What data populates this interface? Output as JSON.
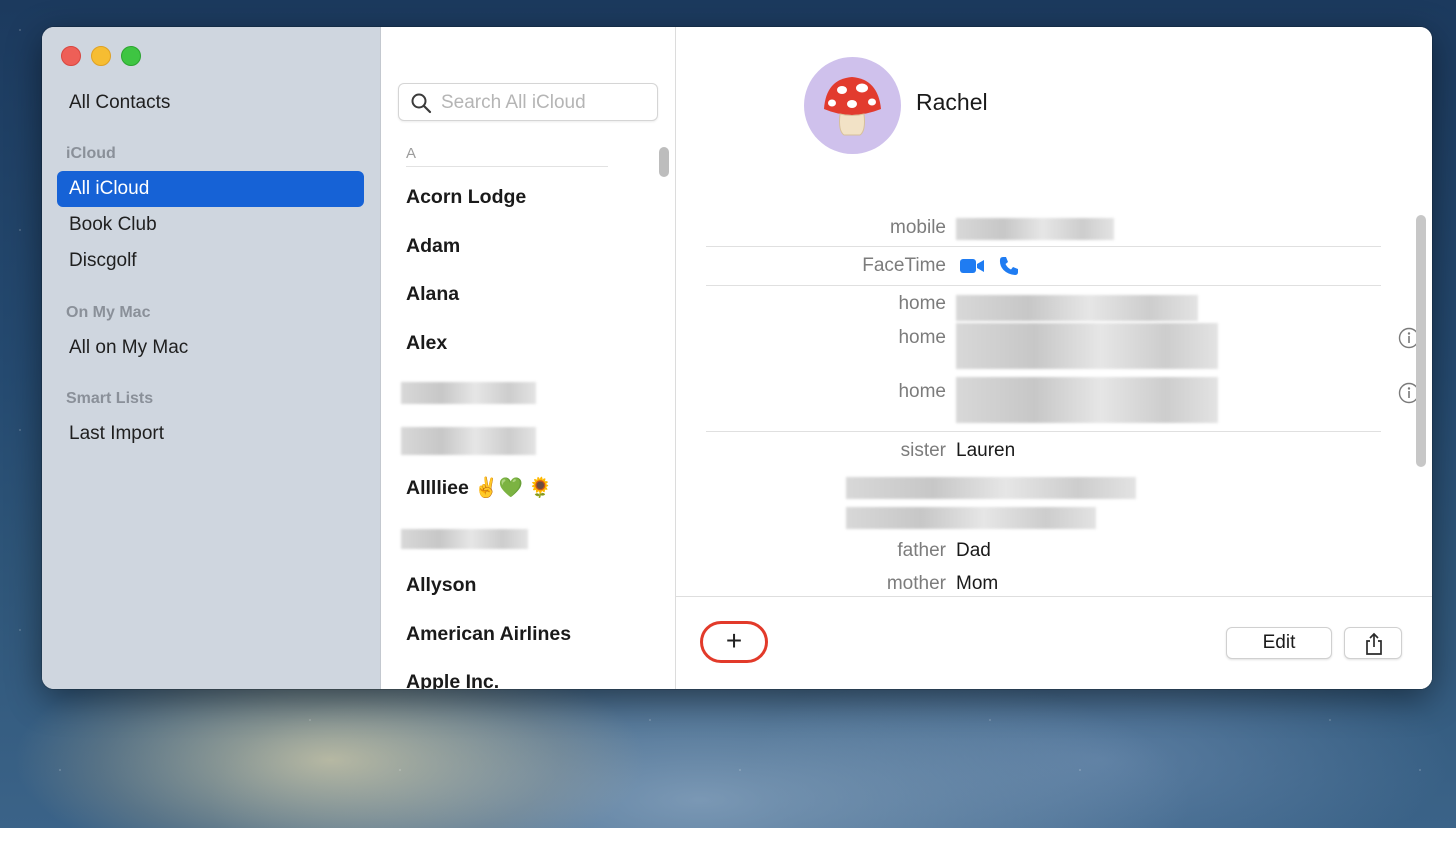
{
  "sidebar": {
    "all_contacts": "All Contacts",
    "sections": [
      {
        "header": "iCloud",
        "items": [
          "All iCloud",
          "Book Club",
          "Discgolf"
        ]
      },
      {
        "header": "On My Mac",
        "items": [
          "All on My Mac"
        ]
      },
      {
        "header": "Smart Lists",
        "items": [
          "Last Import"
        ]
      }
    ],
    "selected": "All iCloud"
  },
  "list": {
    "search_placeholder": "Search All iCloud",
    "section_letter": "A",
    "contacts": [
      "Acorn Lodge",
      "Adam",
      "Alana",
      "Alex",
      "Allllie​e ✌️💚 🌻",
      "Allyson",
      "American Airlines",
      "Apple Inc."
    ]
  },
  "detail": {
    "name": "Rachel",
    "avatar_emoji": "🍄",
    "fields": {
      "mobile_label": "mobile",
      "facetime_label": "FaceTime",
      "home1_label": "home",
      "home2_label": "home",
      "home3_label": "home",
      "sister_label": "sister",
      "sister_value": "Lauren",
      "father_label": "father",
      "father_value": "Dad",
      "mother_label": "mother",
      "mother_value": "Mom"
    },
    "footer": {
      "add_label": "+",
      "edit_label": "Edit"
    }
  },
  "colors": {
    "accent": "#1662d6",
    "facetime_blue": "#1f7cf2",
    "highlight_ring": "#e23a2a"
  }
}
